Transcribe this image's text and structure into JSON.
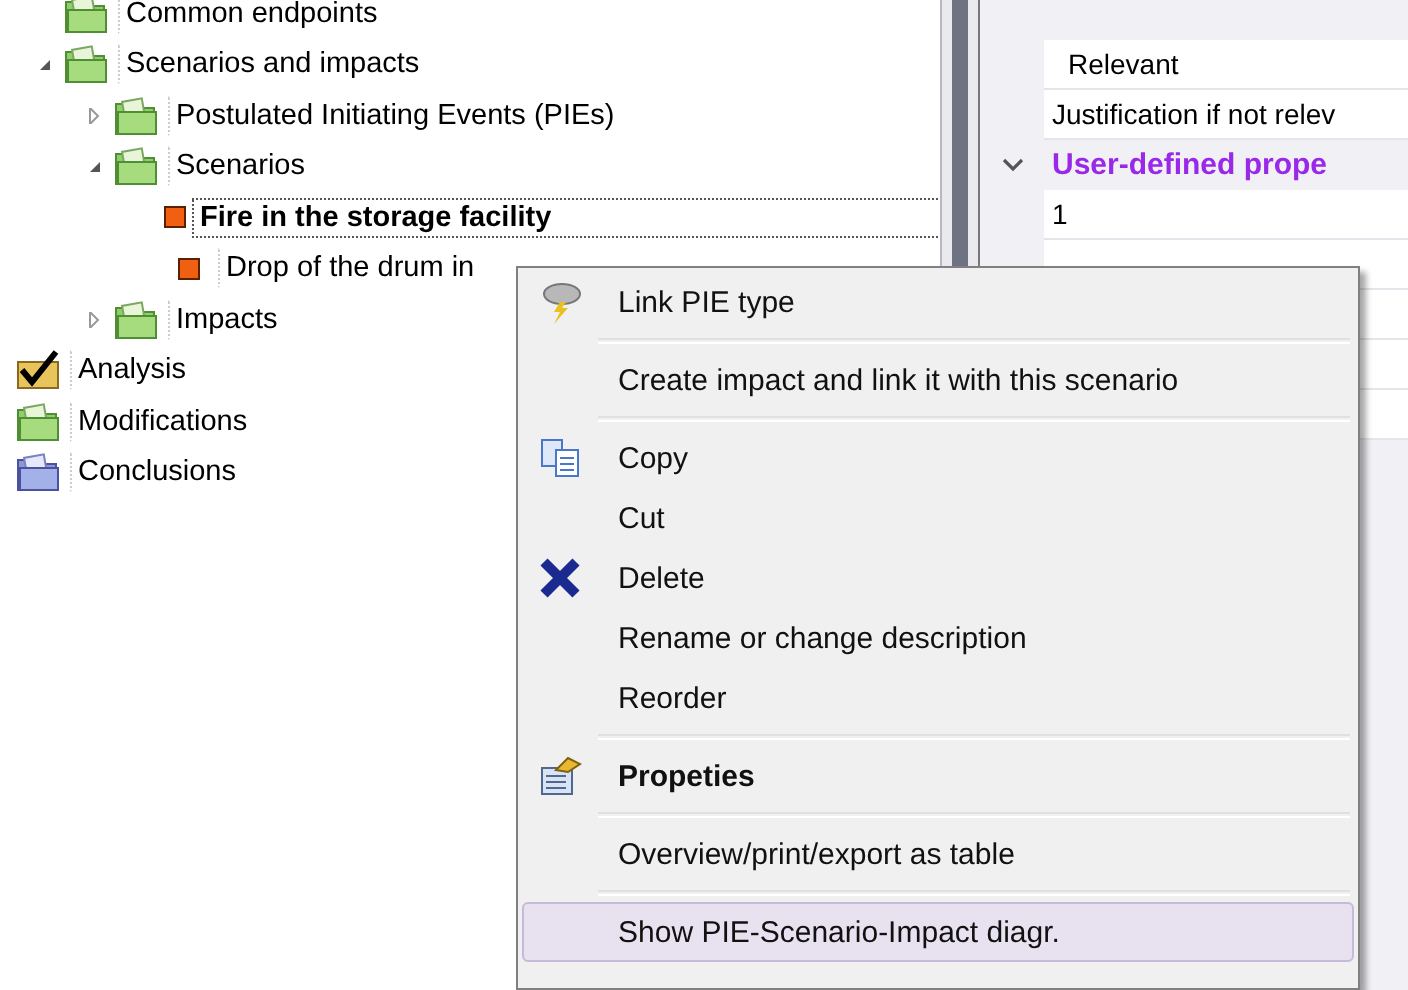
{
  "tree": {
    "partial_children": [
      {
        "label": "Common endpoints",
        "kind": "folder",
        "selected": false
      },
      {
        "label": "Scenarios and impacts",
        "kind": "folder",
        "selected": false,
        "expanded": true,
        "children": [
          {
            "label": "Postulated Initiating Events (PIEs)",
            "kind": "folder",
            "selected": false,
            "expanded": false
          },
          {
            "label": "Scenarios",
            "kind": "folder",
            "selected": false,
            "expanded": true,
            "children": [
              {
                "label": "Fire in the storage facility",
                "kind": "scenario",
                "selected": true
              },
              {
                "label": "Drop of the drum in",
                "kind": "scenario",
                "selected": false
              }
            ]
          },
          {
            "label": "Impacts",
            "kind": "folder",
            "selected": false,
            "expanded": false
          }
        ]
      }
    ],
    "items": [
      {
        "label": "Analysis",
        "kind": "analysis",
        "selected": false
      },
      {
        "label": "Modifications",
        "kind": "folder",
        "selected": false
      },
      {
        "label": "Conclusions",
        "kind": "conclusions",
        "selected": false
      }
    ]
  },
  "properties": {
    "rows": [
      {
        "kind": "value",
        "label": "Relevant"
      },
      {
        "kind": "value",
        "label": "Justification if not relev"
      },
      {
        "kind": "category",
        "label": "User-defined prope",
        "expanded": true
      },
      {
        "kind": "value",
        "label": "1"
      }
    ]
  },
  "context_menu": {
    "groups": [
      [
        {
          "label": "Link PIE type",
          "kind": "link",
          "selected": false
        }
      ],
      [
        {
          "label": "Create impact and link it with this scenario",
          "selected": false
        }
      ],
      [
        {
          "label": "Copy",
          "kind": "copy",
          "selected": false
        },
        {
          "label": "Cut",
          "selected": false
        },
        {
          "label": "Delete",
          "kind": "delete",
          "selected": false
        },
        {
          "label": "Rename or change description",
          "selected": false
        },
        {
          "label": "Reorder",
          "selected": false
        }
      ],
      [
        {
          "label": "Propeties",
          "kind": "properties",
          "bold": true,
          "selected": false
        }
      ],
      [
        {
          "label": "Overview/print/export as table",
          "selected": false
        }
      ],
      [
        {
          "label": "Show PIE-Scenario-Impact diagr.",
          "selected": true
        }
      ]
    ]
  }
}
